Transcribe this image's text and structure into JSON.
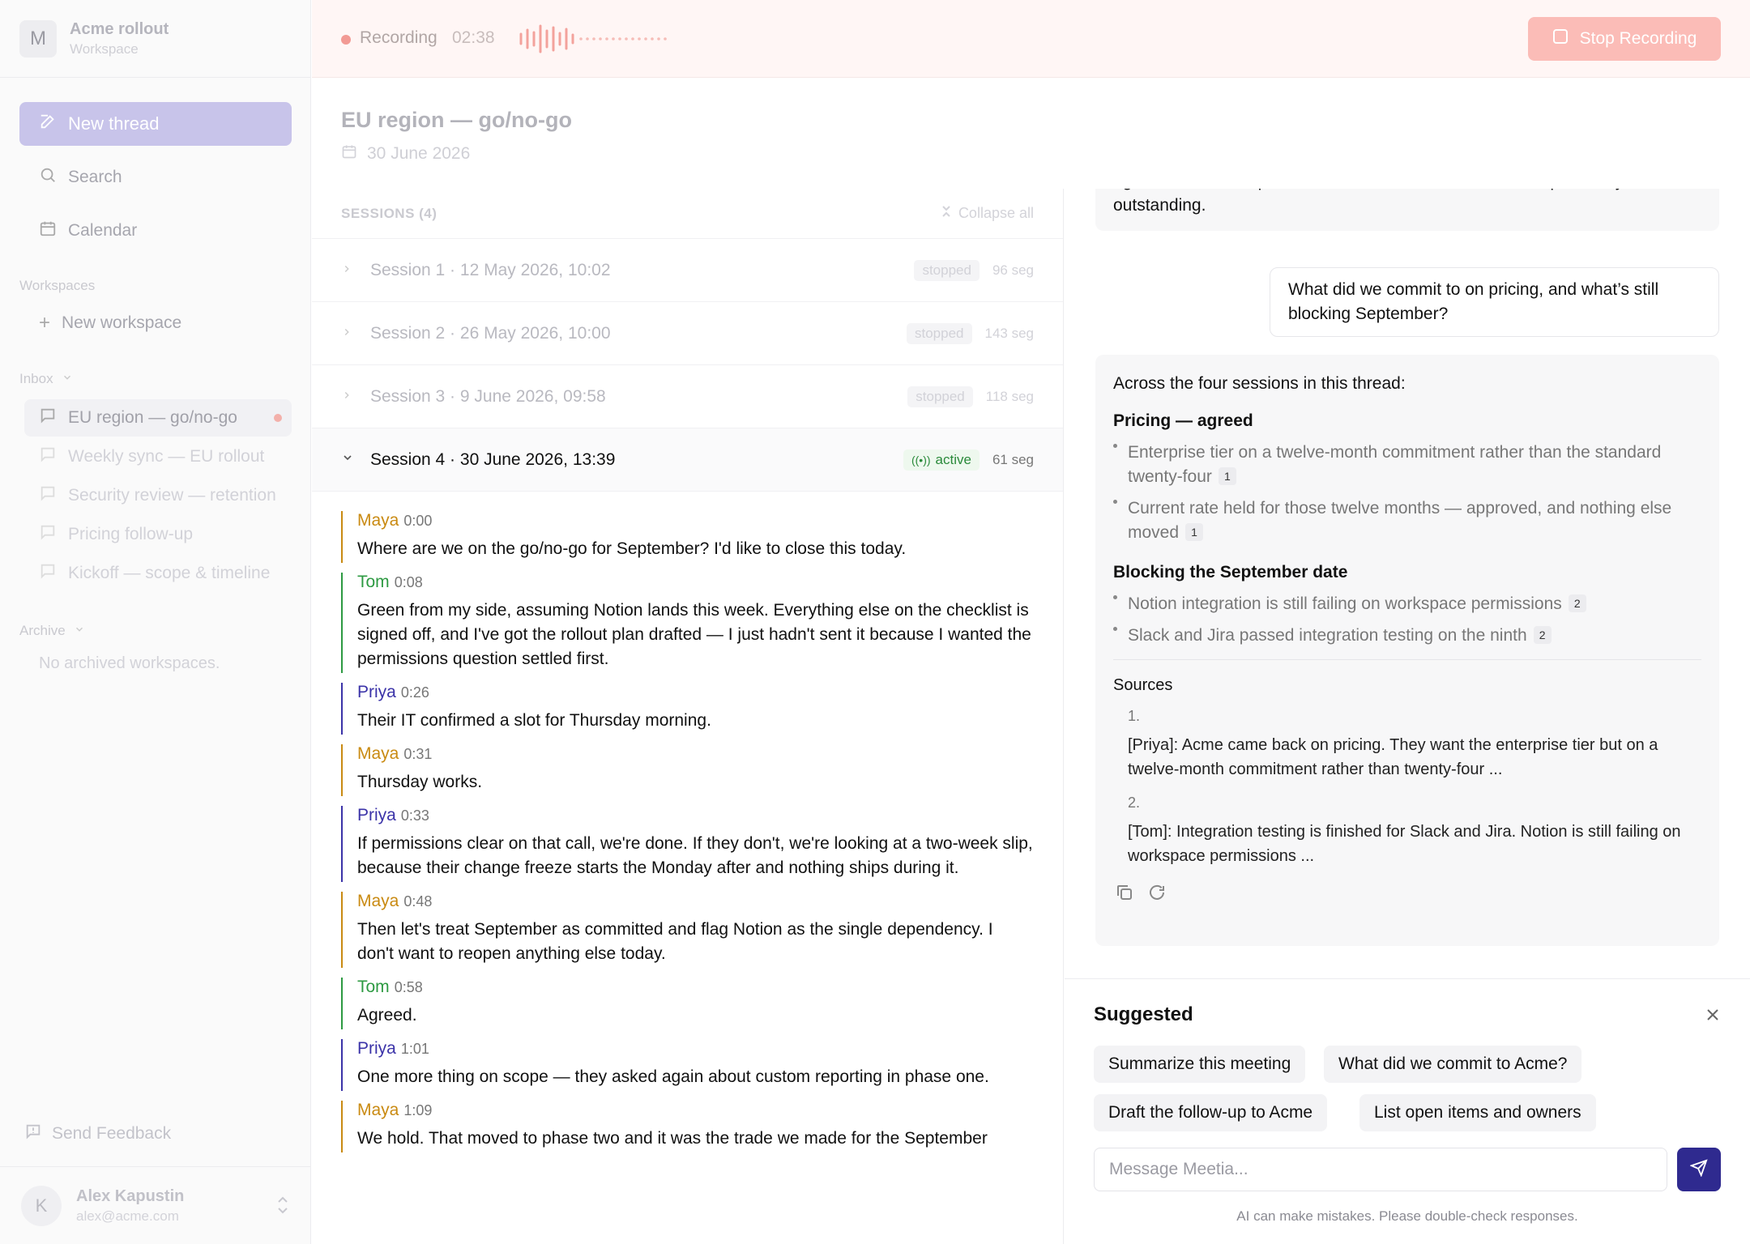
{
  "sidebar": {
    "workspace_initial": "M",
    "workspace_name": "Acme rollout",
    "workspace_sub": "Workspace",
    "new_thread": "New thread",
    "search": "Search",
    "calendar": "Calendar",
    "workspaces_label": "Workspaces",
    "new_workspace": "New workspace",
    "inbox_label": "Inbox",
    "inbox_items": [
      {
        "label": "EU region — go/no-go"
      },
      {
        "label": "Weekly sync — EU rollout"
      },
      {
        "label": "Security review — retention"
      },
      {
        "label": "Pricing follow-up"
      },
      {
        "label": "Kickoff — scope & timeline"
      }
    ],
    "archive_label": "Archive",
    "archive_empty": "No archived workspaces.",
    "send_feedback": "Send Feedback",
    "user_initial": "K",
    "user_name": "Alex Kapustin",
    "user_email": "alex@acme.com"
  },
  "topbar": {
    "recording_label": "Recording",
    "recording_time": "02:38",
    "stop_label": "Stop Recording"
  },
  "thread": {
    "title": "EU region — go/no-go",
    "date": "30 June 2026"
  },
  "sessions": {
    "header": "SESSIONS (4)",
    "collapse_all": "Collapse all",
    "items": [
      {
        "title": "Session 1 · 12 May 2026, 10:02",
        "status": "stopped",
        "segs": "96 seg"
      },
      {
        "title": "Session 2 · 26 May 2026, 10:00",
        "status": "stopped",
        "segs": "143 seg"
      },
      {
        "title": "Session 3 · 9 June 2026, 09:58",
        "status": "stopped",
        "segs": "118 seg"
      },
      {
        "title": "Session 4 · 30 June 2026, 13:39",
        "status": "active",
        "segs": "61 seg"
      }
    ]
  },
  "transcript": [
    {
      "speaker": "Maya",
      "time": "0:00",
      "text": "Where are we on the go/no-go for September? I'd like to close this today."
    },
    {
      "speaker": "Tom",
      "time": "0:08",
      "text": "Green from my side, assuming Notion lands this week. Everything else on the checklist is signed off, and I've got the rollout plan drafted — I just hadn't sent it because I wanted the permissions question settled first."
    },
    {
      "speaker": "Priya",
      "time": "0:26",
      "text": "Their IT confirmed a slot for Thursday morning."
    },
    {
      "speaker": "Maya",
      "time": "0:31",
      "text": "Thursday works."
    },
    {
      "speaker": "Priya",
      "time": "0:33",
      "text": "If permissions clear on that call, we're done. If they don't, we're looking at a two-week slip, because their change freeze starts the Monday after and nothing ships during it."
    },
    {
      "speaker": "Maya",
      "time": "0:48",
      "text": "Then let's treat September as committed and flag Notion as the single dependency. I don't want to reopen anything else today."
    },
    {
      "speaker": "Tom",
      "time": "0:58",
      "text": "Agreed."
    },
    {
      "speaker": "Priya",
      "time": "1:01",
      "text": "One more thing on scope — they asked again about custom reporting in phase one."
    },
    {
      "speaker": "Maya",
      "time": "1:09",
      "text": "We hold. That moved to phase two and it was the trade we made for the September"
    }
  ],
  "speaker_colors": {
    "Maya": "#c98a12",
    "Tom": "#2d9a42",
    "Priya": "#3b33a8"
  },
  "chat": {
    "prev_ai_tail": "agreed, and the September date is committed with one dependency outstanding.",
    "user_question": "What did we commit to on pricing, and what’s still blocking September?",
    "answer_intro": "Across the four sessions in this thread:",
    "pricing_heading": "Pricing — agreed",
    "pricing_bullets": [
      {
        "text": "Enterprise tier on a twelve-month commitment rather than the standard twenty-four",
        "cite": "1"
      },
      {
        "text": "Current rate held for those twelve months — approved, and nothing else moved",
        "cite": "1"
      }
    ],
    "blocking_heading": "Blocking the September date",
    "blocking_bullets": [
      {
        "text": "Notion integration is still failing on workspace permissions",
        "cite": "2"
      },
      {
        "text": "Slack and Jira passed integration testing on the ninth",
        "cite": "2"
      }
    ],
    "sources_label": "Sources",
    "sources": [
      {
        "num": "1.",
        "text": "[Priya]: Acme came back on pricing. They want the enterprise tier but on a twelve-month commitment rather than twenty-four ..."
      },
      {
        "num": "2.",
        "text": "[Tom]: Integration testing is finished for Slack and Jira. Notion is still failing on workspace permissions ..."
      }
    ]
  },
  "composer": {
    "suggested_title": "Suggested",
    "chips": [
      "Summarize this meeting",
      "What did we commit to Acme?",
      "Draft the follow-up to Acme",
      "List open items and owners"
    ],
    "placeholder": "Message Meetia...",
    "disclaimer": "AI can make mistakes. Please double-check responses."
  }
}
